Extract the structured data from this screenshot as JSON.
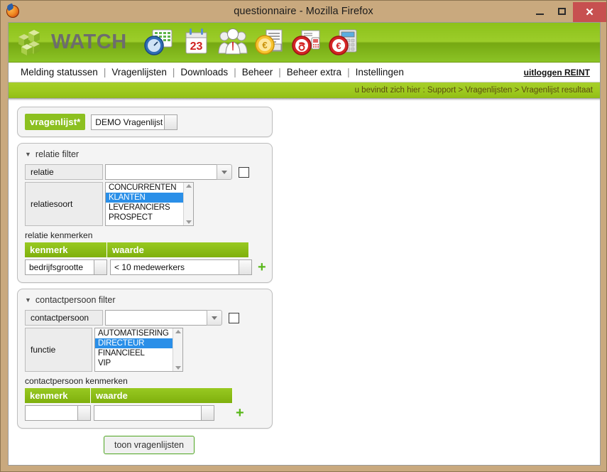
{
  "window": {
    "title": "questionnaire - Mozilla Firefox",
    "app_icon": "firefox-icon",
    "minimize_label": "–",
    "maximize_label": "□",
    "close_label": "✕"
  },
  "brand": {
    "name": "WATCH",
    "logo_icon": "watch-cube-logo",
    "toolbar_icons": [
      "time-registration-icon",
      "calendar-23-icon",
      "contacts-group-icon",
      "invoice-euro-icon",
      "phone-fax-icon",
      "euro-calculator-icon"
    ]
  },
  "nav": {
    "items": [
      "Melding statussen",
      "Vragenlijsten",
      "Downloads",
      "Beheer",
      "Beheer extra",
      "Instellingen"
    ],
    "separator": "|",
    "logout": "uitloggen REINT"
  },
  "breadcrumb": {
    "text": "u bevindt zich hier : Support > Vragenlijsten > Vragenlijst resultaat"
  },
  "questionnaire": {
    "label": "vragenlijst*",
    "selected": "DEMO Vragenlijst",
    "options": [
      "DEMO Vragenlijst"
    ]
  },
  "relatie_filter": {
    "title": "relatie filter",
    "caret": "▼",
    "relatie": {
      "label": "relatie",
      "value": "",
      "placeholder": "",
      "checkbox_checked": false
    },
    "relatiesoort": {
      "label": "relatiesoort",
      "options": [
        "CONCURRENTEN",
        "KLANTEN",
        "LEVERANCIERS",
        "PROSPECT"
      ],
      "selected": "KLANTEN"
    },
    "kenmerken": {
      "title": "relatie kenmerken",
      "columns": [
        "kenmerk",
        "waarde"
      ],
      "rows": [
        {
          "kenmerk": "bedrijfsgrootte",
          "waarde": "< 10 medewerkers"
        }
      ],
      "add_label": "+"
    }
  },
  "contactpersoon_filter": {
    "title": "contactpersoon filter",
    "caret": "▼",
    "contactpersoon": {
      "label": "contactpersoon",
      "value": "",
      "placeholder": "",
      "checkbox_checked": false
    },
    "functie": {
      "label": "functie",
      "options": [
        "AUTOMATISERING",
        "DIRECTEUR",
        "FINANCIEEL",
        "VIP"
      ],
      "selected": "DIRECTEUR"
    },
    "kenmerken": {
      "title": "contactpersoon kenmerken",
      "columns": [
        "kenmerk",
        "waarde"
      ],
      "rows": [
        {
          "kenmerk": "",
          "waarde": ""
        }
      ],
      "add_label": "+"
    }
  },
  "submit": {
    "label": "toon vragenlijsten"
  },
  "colors": {
    "brand_green": "#8cc020",
    "header_green": "#9ccd2a",
    "select_blue": "#2a8fe8",
    "frame_tan": "#c9a97e",
    "close_red": "#c75050"
  }
}
